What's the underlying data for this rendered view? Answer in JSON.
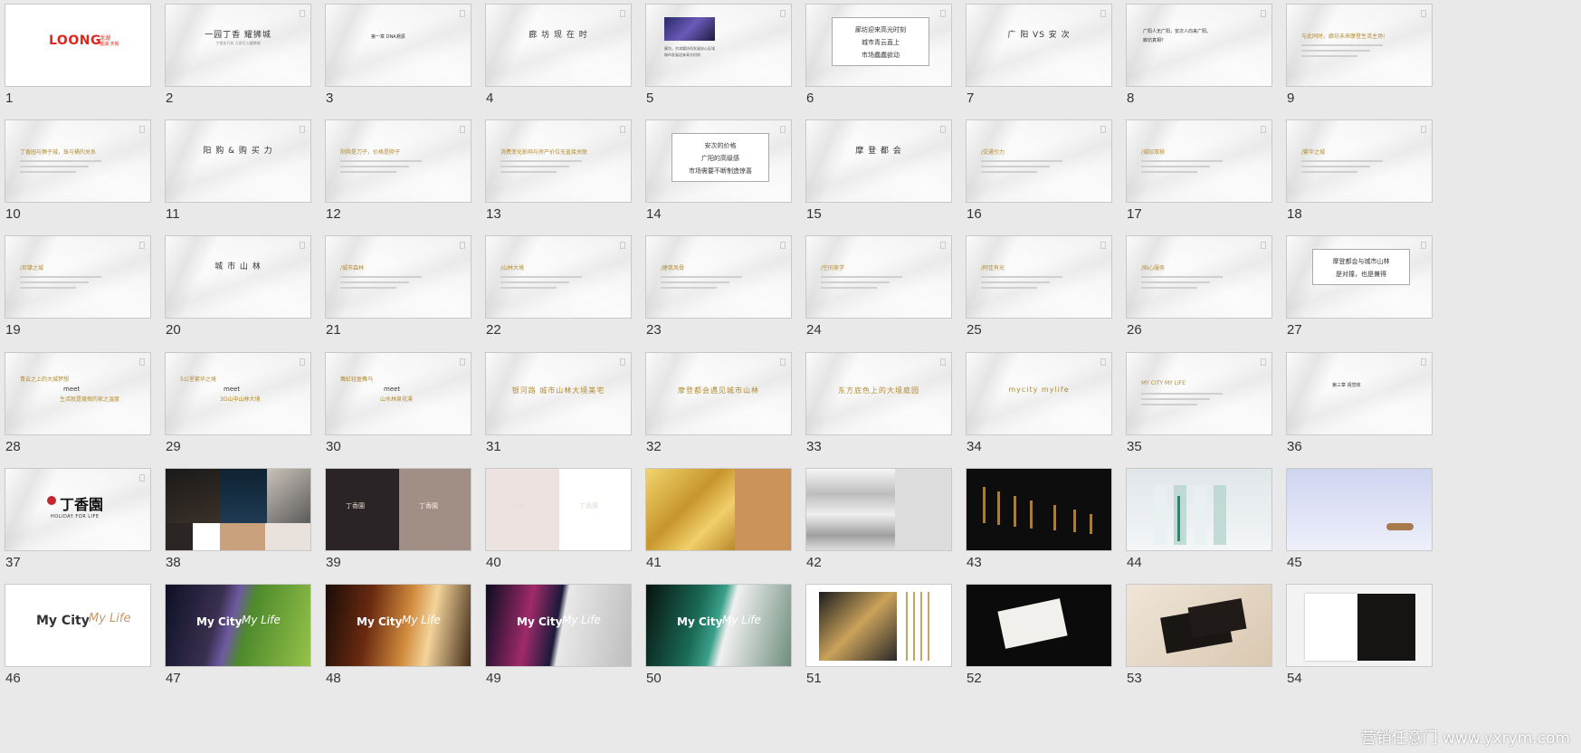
{
  "slides": [
    {
      "num": "1",
      "type": "logo",
      "logo": "LOONG",
      "logo_cn": "龙湖",
      "sub": "龍湖·天街"
    },
    {
      "num": "2",
      "type": "title",
      "title": "一园丁香  耀狮城",
      "sub": "丁香花开处  万家灯火耀狮城"
    },
    {
      "num": "3",
      "type": "title_small",
      "title": "第一章  DNA溯源"
    },
    {
      "num": "4",
      "type": "title",
      "title": "廊 坊 现 在 时"
    },
    {
      "num": "5",
      "type": "photo_text",
      "lines": [
        "廊坊，京津冀协同发展核心区域",
        "城市发展迎来高光时刻"
      ]
    },
    {
      "num": "6",
      "type": "boxed",
      "lines": [
        "廊坊迎来高光时刻",
        "城市青云直上",
        "市场蠢蠢欲动"
      ]
    },
    {
      "num": "7",
      "type": "title",
      "title": "广 阳 VS 安 次"
    },
    {
      "num": "8",
      "type": "text_dark",
      "lines": [
        "广阳人无广阳，安次人向来广阳。",
        "廊坊真相？"
      ]
    },
    {
      "num": "9",
      "type": "text_gold",
      "lines": [
        "与此同时，廊坊未来摩登生活主场!"
      ]
    },
    {
      "num": "10",
      "type": "text_gold",
      "lines": [
        "丁香园与狮子城，珠与桶的关系"
      ]
    },
    {
      "num": "11",
      "type": "title",
      "title": "阳 购 & 购 买 力"
    },
    {
      "num": "12",
      "type": "text_gold",
      "lines": [
        "阳购是刀子，价格是脖子"
      ]
    },
    {
      "num": "13",
      "type": "text_gold",
      "lines": [
        "消费变化影响与房产价位无直接关联"
      ]
    },
    {
      "num": "14",
      "type": "boxed",
      "lines": [
        "安次的价格",
        "广阳的高级感",
        "市场需要不断制造惊喜"
      ]
    },
    {
      "num": "15",
      "type": "title",
      "title": "摩 登 都 会"
    },
    {
      "num": "16",
      "type": "text_gold",
      "lines": [
        "/交通引力"
      ]
    },
    {
      "num": "17",
      "type": "text_gold",
      "lines": [
        "/城际双核"
      ]
    },
    {
      "num": "18",
      "type": "text_gold",
      "lines": [
        "/繁华之城"
      ]
    },
    {
      "num": "19",
      "type": "text_gold",
      "lines": [
        "/巨擘之城"
      ]
    },
    {
      "num": "20",
      "type": "title",
      "title": "城 市 山 林"
    },
    {
      "num": "21",
      "type": "text_gold",
      "lines": [
        "/城市森林"
      ]
    },
    {
      "num": "22",
      "type": "text_gold",
      "lines": [
        "/山林大境"
      ]
    },
    {
      "num": "23",
      "type": "text_gold",
      "lines": [
        "/建筑风骨"
      ]
    },
    {
      "num": "24",
      "type": "text_gold",
      "lines": [
        "/空间美学"
      ]
    },
    {
      "num": "25",
      "type": "text_gold",
      "lines": [
        "/阿佳有光"
      ]
    },
    {
      "num": "26",
      "type": "text_gold",
      "lines": [
        "/贴心服务"
      ]
    },
    {
      "num": "27",
      "type": "boxed",
      "lines": [
        "摩登都会与城市山林",
        "是对撞，也是兼得"
      ]
    },
    {
      "num": "28",
      "type": "meet",
      "lines": [
        "青云之上的大城梦想",
        "meet",
        "生活就是度假的家之温度"
      ]
    },
    {
      "num": "29",
      "type": "meet",
      "lines": [
        "5公里繁华之境",
        "meet",
        "3D山中山林大境"
      ]
    },
    {
      "num": "30",
      "type": "meet",
      "lines": [
        "舞虹轻盈舞马",
        "meet",
        "山水林泉花溪"
      ]
    },
    {
      "num": "31",
      "type": "title_gold",
      "title": "银河路  城市山林大境美宅"
    },
    {
      "num": "32",
      "type": "title_gold",
      "title": "摩登都会遇见城市山林"
    },
    {
      "num": "33",
      "type": "title_gold",
      "title": "东方底色上的大境庭园"
    },
    {
      "num": "34",
      "type": "title_gold",
      "title": "mycity  mylife"
    },
    {
      "num": "35",
      "type": "text_gold",
      "lines": [
        "MY CITY MY LIFE"
      ]
    },
    {
      "num": "36",
      "type": "title_small",
      "title": "第三章  视觉体"
    },
    {
      "num": "37",
      "type": "brand",
      "cn": "丁香園",
      "en": "HOLIDAY FOR LIFE"
    },
    {
      "num": "38",
      "type": "collage"
    },
    {
      "num": "39",
      "type": "split",
      "left": "#2a2427",
      "right": "#a18f85",
      "label": "丁香園"
    },
    {
      "num": "40",
      "type": "split",
      "left": "#ece3e0",
      "right": "#ffffff",
      "label": "丁香園"
    },
    {
      "num": "41",
      "type": "gold_split"
    },
    {
      "num": "42",
      "type": "silver_split"
    },
    {
      "num": "43",
      "type": "dark_gold"
    },
    {
      "num": "44",
      "type": "glass"
    },
    {
      "num": "45",
      "type": "lavender"
    },
    {
      "num": "46",
      "type": "mycity",
      "a": "My City",
      "b": "My Life"
    },
    {
      "num": "47",
      "type": "mycity_photo",
      "a": "My City",
      "b": "My Life",
      "bg": "night_field"
    },
    {
      "num": "48",
      "type": "mycity_photo",
      "a": "My City",
      "b": "My Life",
      "bg": "bar"
    },
    {
      "num": "49",
      "type": "mycity_photo",
      "a": "My City",
      "b": "My Life",
      "bg": "city_white"
    },
    {
      "num": "50",
      "type": "mycity_photo",
      "a": "My City",
      "b": "My Life",
      "bg": "teal"
    },
    {
      "num": "51",
      "type": "gold_panels"
    },
    {
      "num": "52",
      "type": "card_black"
    },
    {
      "num": "53",
      "type": "card_beige"
    },
    {
      "num": "54",
      "type": "book"
    }
  ],
  "watermark": "营销任意门  www.yxrym.com",
  "colors": {
    "bg": "#e9e9e9",
    "gold": "#b28a2e",
    "loong": "#e1251b"
  }
}
